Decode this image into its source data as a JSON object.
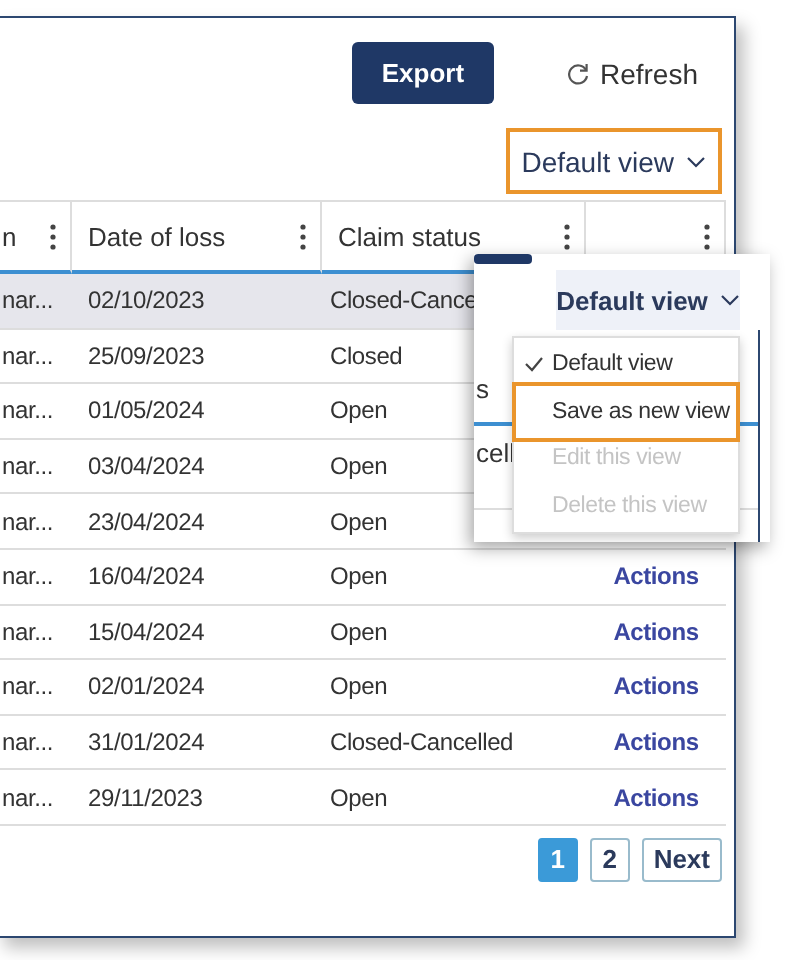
{
  "toolbar": {
    "export_button": "Export",
    "refresh_button": "Refresh"
  },
  "view_select": {
    "label": "Default view",
    "highlighted": true
  },
  "table": {
    "columns": [
      {
        "label": "n"
      },
      {
        "label": "Date of loss"
      },
      {
        "label": "Claim status"
      },
      {}
    ],
    "rows": [
      {
        "column_1": "nar...",
        "date": "02/10/2023",
        "status": "Closed-Cance",
        "selected": true
      },
      {
        "column_1": "nar...",
        "date": "25/09/2023",
        "status": "Closed",
        "selected": false
      },
      {
        "column_1": "nar...",
        "date": "01/05/2024",
        "status": "Open",
        "selected": false
      },
      {
        "column_1": "nar...",
        "date": "03/04/2024",
        "status": "Open",
        "selected": false
      },
      {
        "column_1": "nar...",
        "date": "23/04/2024",
        "status": "Open",
        "selected": false
      },
      {
        "column_1": "nar...",
        "date": "16/04/2024",
        "status": "Open",
        "action": "Actions",
        "selected": false
      },
      {
        "column_1": "nar...",
        "date": "15/04/2024",
        "status": "Open",
        "action": "Actions",
        "selected": false
      },
      {
        "column_1": "nar...",
        "date": "02/01/2024",
        "status": "Open",
        "action": "Actions",
        "selected": false
      },
      {
        "column_1": "nar...",
        "date": "31/01/2024",
        "status": "Closed-Cancelled",
        "action": "Actions",
        "selected": false
      },
      {
        "column_1": "nar...",
        "date": "29/11/2023",
        "status": "Open",
        "action": "Actions",
        "selected": false
      }
    ]
  },
  "pagination": {
    "pages": [
      {
        "label": "1",
        "selected": true
      },
      {
        "label": "2",
        "selected": false
      }
    ],
    "next": "Next"
  },
  "zoom_inset": {
    "button": "Default view",
    "behind_texts": [
      "s",
      "cell"
    ],
    "menu": [
      {
        "label": "Default view",
        "checked": true,
        "disabled": false,
        "highlighted": false
      },
      {
        "label": "Save as new view",
        "checked": false,
        "disabled": false,
        "highlighted": true
      },
      {
        "label": "Edit this view",
        "checked": false,
        "disabled": true,
        "highlighted": false
      },
      {
        "label": "Delete this view",
        "checked": false,
        "disabled": true,
        "highlighted": false
      }
    ]
  }
}
